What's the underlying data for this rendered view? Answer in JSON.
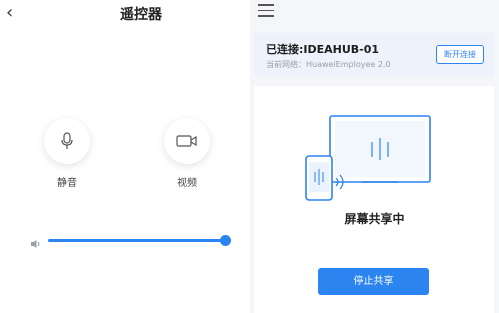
{
  "remote": {
    "title": "遥控器",
    "mic_label": "静音",
    "video_label": "视频",
    "volume_level_percent": 100
  },
  "connection": {
    "status": "已连接:IDEAHUB-01",
    "network": "当前网络：HuaweiEmployee 2.0",
    "disconnect_label": "断开连接"
  },
  "sharing": {
    "status_text": "屏幕共享中",
    "stop_label": "停止共享"
  },
  "colors": {
    "accent": "#2c84f0",
    "panel_bg": "#f4f6fa"
  }
}
